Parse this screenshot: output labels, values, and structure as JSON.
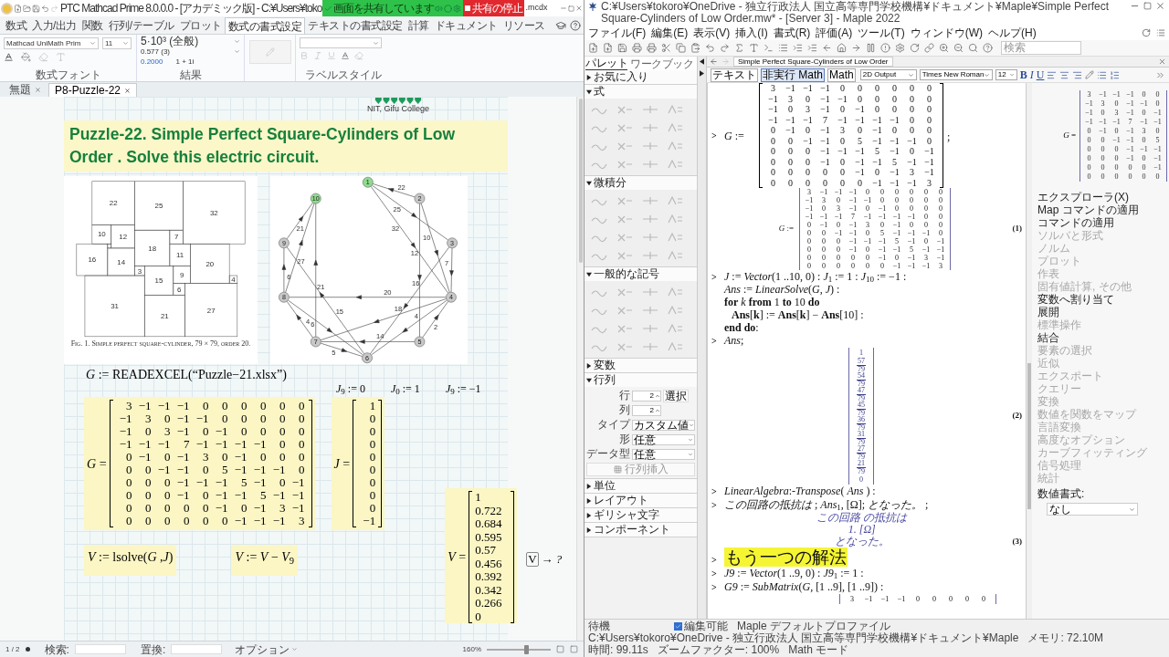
{
  "mathcad": {
    "title": "PTC Mathcad Prime 8.0.0.0 - [アカデミック版] - C:¥Users¥toko",
    "title_end": ".mcdx",
    "share_banner": {
      "text": "画面を共有しています",
      "stop": "共有の停止"
    },
    "ribbon_tabs": [
      {
        "label": "数式",
        "selected": false
      },
      {
        "label": "入力/出力",
        "selected": false
      },
      {
        "label": "関数",
        "selected": false
      },
      {
        "label": "行列/テーブル",
        "selected": false
      },
      {
        "label": "プロット",
        "selected": false
      },
      {
        "label": "数式の書式設定",
        "selected": true
      },
      {
        "label": "テキストの書式設定",
        "selected": false
      },
      {
        "label": "計算",
        "selected": false
      },
      {
        "label": "ドキュメント",
        "selected": false
      },
      {
        "label": "リソース",
        "selected": false
      }
    ],
    "ribbon": {
      "font": "Mathcad UniMath Prim",
      "size": "11",
      "result_format": "5·10³ (全般)",
      "precision": "0.577 (3)",
      "threshold": "0.2000",
      "complex": "1 + 1i",
      "groups": [
        "数式フォント",
        "結果",
        "ラベルスタイル"
      ]
    },
    "doc_tabs": [
      {
        "label": "無題",
        "selected": false
      },
      {
        "label": "P8-Puzzle-22",
        "selected": true
      }
    ],
    "logo": "NIT, Gifu College",
    "heading": "Puzzle-22. Simple Perfect Square-Cylinders of Low Order . Solve this electric circuit.",
    "squares": [
      {
        "label": "22"
      },
      {
        "label": "25"
      },
      {
        "label": "32"
      },
      {
        "label": "10"
      },
      {
        "label": "12"
      },
      {
        "label": "7"
      },
      {
        "label": "18"
      },
      {
        "label": "16"
      },
      {
        "label": "14"
      },
      {
        "label": "11"
      },
      {
        "label": "20"
      },
      {
        "label": "3"
      },
      {
        "label": "15"
      },
      {
        "label": "9"
      },
      {
        "label": "4"
      },
      {
        "label": "6"
      },
      {
        "label": "31"
      },
      {
        "label": "21"
      },
      {
        "label": "27"
      }
    ],
    "caption": "Fig. 1.  Simple perfect square-cylinder, 79 × 79, order 20.",
    "graph": {
      "nodes": [
        {
          "label": "1",
          "color": "#8fdc8f"
        },
        {
          "label": "2",
          "color": "#c8c8c8"
        },
        {
          "label": "3",
          "color": "#c8c8c8"
        },
        {
          "label": "4",
          "color": "#c8c8c8"
        },
        {
          "label": "5",
          "color": "#c8c8c8"
        },
        {
          "label": "6",
          "color": "#c8c8c8"
        },
        {
          "label": "7",
          "color": "#c8c8c8"
        },
        {
          "label": "8",
          "color": "#c8c8c8"
        },
        {
          "label": "9",
          "color": "#c8c8c8"
        },
        {
          "label": "10",
          "color": "#8fdc8f"
        }
      ],
      "edges": [
        {
          "label": "22"
        },
        {
          "label": "25"
        },
        {
          "label": "32"
        },
        {
          "label": "10"
        },
        {
          "label": "12"
        },
        {
          "label": "7"
        },
        {
          "label": "16"
        },
        {
          "label": "20"
        },
        {
          "label": "18"
        },
        {
          "label": "4"
        },
        {
          "label": "2"
        },
        {
          "label": "14"
        },
        {
          "label": "21"
        },
        {
          "label": "21"
        },
        {
          "label": "27"
        },
        {
          "label": "6"
        },
        {
          "label": "15"
        },
        {
          "label": "4"
        },
        {
          "label": "6"
        },
        {
          "label": "5"
        }
      ]
    },
    "readexcel": "*G* := READEXCEL(“Puzzle−21.xlsx”)",
    "j_assign": [
      "*J*$_{9}$ := 0",
      "*J*$_{0}$ := 1",
      "*J*$_{9}$ := −1"
    ],
    "G": {
      "label": "*G* =",
      "rows": [
        [
          "3",
          "−1",
          "−1",
          "−1",
          "0",
          "0",
          "0",
          "0",
          "0",
          "0"
        ],
        [
          "−1",
          "3",
          "0",
          "−1",
          "−1",
          "0",
          "0",
          "0",
          "0",
          "0"
        ],
        [
          "−1",
          "0",
          "3",
          "−1",
          "0",
          "−1",
          "0",
          "0",
          "0",
          "0"
        ],
        [
          "−1",
          "−1",
          "−1",
          "7",
          "−1",
          "−1",
          "−1",
          "−1",
          "0",
          "0"
        ],
        [
          "0",
          "−1",
          "0",
          "−1",
          "3",
          "0",
          "−1",
          "0",
          "0",
          "0"
        ],
        [
          "0",
          "0",
          "−1",
          "−1",
          "0",
          "5",
          "−1",
          "−1",
          "−1",
          "0"
        ],
        [
          "0",
          "0",
          "0",
          "−1",
          "−1",
          "−1",
          "5",
          "−1",
          "0",
          "−1"
        ],
        [
          "0",
          "0",
          "0",
          "−1",
          "0",
          "−1",
          "−1",
          "5",
          "−1",
          "−1"
        ],
        [
          "0",
          "0",
          "0",
          "0",
          "0",
          "−1",
          "0",
          "−1",
          "3",
          "−1"
        ],
        [
          "0",
          "0",
          "0",
          "0",
          "0",
          "0",
          "−1",
          "−1",
          "−1",
          "3"
        ]
      ]
    },
    "J": {
      "label": "*J* =",
      "values": [
        "1",
        "0",
        "0",
        "0",
        "0",
        "0",
        "0",
        "0",
        "0",
        "−1"
      ]
    },
    "lsolve": "*V* := lsolve(*G* ,*J*)",
    "shift": "*V* := *V* − *V*$_{9}$",
    "V": {
      "label": "*V* =",
      "values": [
        "1",
        "0.722",
        "0.684",
        "0.595",
        "0.57",
        "0.456",
        "0.392",
        "0.342",
        "0.266",
        "0"
      ]
    },
    "symbolic": {
      "var": "V",
      "op": "→ ?"
    },
    "status": {
      "page": "1 / 2",
      "search": "検索:",
      "replace": "置換:",
      "options": "オプション",
      "zoom": "160%",
      "zoom_slider": {
        "level": 0.62
      }
    }
  },
  "maple": {
    "title": "C:¥Users¥tokoro¥OneDrive - 独立行政法人 国立高等専門学校機構¥ドキュメント¥Maple¥Simple Perfect Square-Cylinders of Low Order.mw* - [Server 3] - Maple 2022",
    "menu": [
      "ファイル(F)",
      "編集(E)",
      "表示(V)",
      "挿入(I)",
      "書式(R)",
      "評価(A)",
      "ツール(T)",
      "ウィンドウ(W)",
      "ヘルプ(H)"
    ],
    "search_placeholder": "検索",
    "palette_tabs": [
      {
        "label": "パレット",
        "selected": true
      },
      {
        "label": "ワークブック",
        "selected": false
      }
    ],
    "doc_tab": "Simple Perfect Square-Cylinders of Low Order",
    "format_bar": {
      "modes": [
        {
          "label": "テキスト",
          "selected": false
        },
        {
          "label": "非実行 Math",
          "selected": true
        },
        {
          "label": "Math",
          "selected": false
        }
      ],
      "style": "2D Output",
      "font": "Times New Roman",
      "size": "12",
      "text_styles": [
        "B",
        "I",
        "U"
      ]
    },
    "palettes": [
      {
        "label": "お気に入り",
        "expanded": false
      },
      {
        "label": "式",
        "expanded": true,
        "kind": "symbols"
      },
      {
        "label": "微積分",
        "expanded": true,
        "kind": "symbols"
      },
      {
        "label": "一般的な記号",
        "expanded": true,
        "kind": "symbols"
      },
      {
        "label": "変数",
        "expanded": false
      },
      {
        "label": "行列",
        "expanded": true,
        "kind": "matrix",
        "fields": [
          {
            "label": "行",
            "value": "2",
            "kind": "spin"
          },
          {
            "label": "列",
            "value": "2",
            "kind": "spin"
          },
          {
            "label": "タイプ",
            "value": "カスタム値",
            "kind": "select"
          },
          {
            "label": "形",
            "value": "任意",
            "kind": "select"
          },
          {
            "label": "データ型",
            "value": "任意",
            "kind": "select"
          }
        ],
        "select_button": "選択",
        "insert_button": "行列挿入"
      },
      {
        "label": "単位",
        "expanded": false
      },
      {
        "label": "レイアウト",
        "expanded": false
      },
      {
        "label": "ギリシャ文字",
        "expanded": false
      },
      {
        "label": "コンポーネント",
        "expanded": false
      }
    ],
    "worksheet": [
      {
        "kind": "input_matrix",
        "prompt": ">",
        "name": "*G* :=",
        "end": ";",
        "rows": [
          [
            "3",
            "−1",
            "−1",
            "−1",
            "0",
            "0",
            "0",
            "0",
            "0",
            "0"
          ],
          [
            "−1",
            "3",
            "0",
            "−1",
            "−1",
            "0",
            "0",
            "0",
            "0",
            "0"
          ],
          [
            "−1",
            "0",
            "3",
            "−1",
            "0",
            "−1",
            "0",
            "0",
            "0",
            "0"
          ],
          [
            "−1",
            "−1",
            "−1",
            "7",
            "−1",
            "−1",
            "−1",
            "−1",
            "0",
            "0"
          ],
          [
            "0",
            "−1",
            "0",
            "−1",
            "3",
            "0",
            "−1",
            "0",
            "0",
            "0"
          ],
          [
            "0",
            "0",
            "−1",
            "−1",
            "0",
            "5",
            "−1",
            "−1",
            "−1",
            "0"
          ],
          [
            "0",
            "0",
            "0",
            "−1",
            "−1",
            "−1",
            "5",
            "−1",
            "0",
            "−1"
          ],
          [
            "0",
            "0",
            "0",
            "−1",
            "0",
            "−1",
            "−1",
            "5",
            "−1",
            "−1"
          ],
          [
            "0",
            "0",
            "0",
            "0",
            "0",
            "−1",
            "0",
            "−1",
            "3",
            "−1"
          ],
          [
            "0",
            "0",
            "0",
            "0",
            "0",
            "0",
            "−1",
            "−1",
            "−1",
            "3"
          ]
        ]
      },
      {
        "kind": "output_matrix",
        "name": "*G* :=",
        "tag": "(1)",
        "rows": [
          [
            "3",
            "−1",
            "−1",
            "−1",
            "0",
            "0",
            "0",
            "0",
            "0",
            "0"
          ],
          [
            "−1",
            "3",
            "0",
            "−1",
            "−1",
            "0",
            "0",
            "0",
            "0",
            "0"
          ],
          [
            "−1",
            "0",
            "3",
            "−1",
            "0",
            "−1",
            "0",
            "0",
            "0",
            "0"
          ],
          [
            "−1",
            "−1",
            "−1",
            "7",
            "−1",
            "−1",
            "−1",
            "−1",
            "0",
            "0"
          ],
          [
            "0",
            "−1",
            "0",
            "−1",
            "3",
            "0",
            "−1",
            "0",
            "0",
            "0"
          ],
          [
            "0",
            "0",
            "−1",
            "−1",
            "0",
            "5",
            "−1",
            "−1",
            "−1",
            "0"
          ],
          [
            "0",
            "0",
            "0",
            "−1",
            "−1",
            "−1",
            "5",
            "−1",
            "0",
            "−1"
          ],
          [
            "0",
            "0",
            "0",
            "−1",
            "0",
            "−1",
            "−1",
            "5",
            "−1",
            "−1"
          ],
          [
            "0",
            "0",
            "0",
            "0",
            "0",
            "−1",
            "0",
            "−1",
            "3",
            "−1"
          ],
          [
            "0",
            "0",
            "0",
            "0",
            "0",
            "0",
            "−1",
            "−1",
            "−1",
            "3"
          ]
        ]
      },
      {
        "kind": "input",
        "prompt": ">",
        "lines": [
          {
            "text": "*J* := *Vector*(1 ..10, 0) : *J*$_{1}$ := 1 : *J*$_{10}$ := −1 :"
          },
          {
            "text": "*Ans* := *LinearSolve*(*G*, *J*) :"
          },
          {
            "text": "**for** *k* **from** 1 **to** 10 **do**",
            "children": [
              {
                "text": "**Ans**[**k**] := **Ans**[**k**] − **Ans**[10] :"
              }
            ]
          },
          {
            "text": "**end do**:"
          }
        ]
      },
      {
        "kind": "input",
        "prompt": ">",
        "lines": [
          {
            "text": "*Ans*;"
          }
        ]
      },
      {
        "kind": "vector_output",
        "tag": "(2)",
        "entries": [
          {
            "num": "1"
          },
          {
            "num": "57",
            "den": "79"
          },
          {
            "num": "54",
            "den": "79"
          },
          {
            "num": "47",
            "den": "79"
          },
          {
            "num": "45",
            "den": "79"
          },
          {
            "num": "36",
            "den": "79"
          },
          {
            "num": "31",
            "den": "79"
          },
          {
            "num": "27",
            "den": "79"
          },
          {
            "num": "21",
            "den": "79"
          },
          {
            "num": "0"
          }
        ]
      },
      {
        "kind": "input",
        "prompt": ">",
        "lines": [
          {
            "text": "*LinearAlgebra*:-*Transpose*( *Ans* ) :"
          }
        ]
      },
      {
        "kind": "input",
        "prompt": ">",
        "lines": [
          {
            "text": "*この回路の抵抗は* ; *Ans*$_{1}$, [Ω]; *となった。* ;"
          }
        ]
      },
      {
        "kind": "text_output",
        "tag": "(3)",
        "lines": [
          "この回路 の抵抗は",
          "1. [Ω]",
          "となった。"
        ]
      },
      {
        "kind": "heading",
        "prompt": ">",
        "text": "もう一つの解法"
      },
      {
        "kind": "input",
        "prompt": ">",
        "lines": [
          {
            "text": "*J9* := *Vector*(1 ..9, 0) : *J9*$_{1}$ := 1 :"
          }
        ]
      },
      {
        "kind": "input",
        "prompt": ">",
        "lines": [
          {
            "text": "*G9* := *SubMatrix*(*G*, [1 ..9], [1 ..9]) :"
          }
        ]
      },
      {
        "kind": "partial_row",
        "values": [
          "3",
          "−1",
          "−1",
          "−1",
          "0",
          "0",
          "0",
          "0",
          "0"
        ]
      }
    ],
    "side_panel": {
      "name": "*G* =",
      "rows": [
        [
          "3",
          "−1",
          "−1",
          "−1",
          "0",
          "0"
        ],
        [
          "−1",
          "3",
          "0",
          "−1",
          "−1",
          "0"
        ],
        [
          "−1",
          "0",
          "3",
          "−1",
          "0",
          "−1"
        ],
        [
          "−1",
          "−1",
          "−1",
          "7",
          "−1",
          "−1"
        ],
        [
          "0",
          "−1",
          "0",
          "−1",
          "3",
          "0"
        ],
        [
          "0",
          "0",
          "−1",
          "−1",
          "0",
          "5"
        ],
        [
          "0",
          "0",
          "0",
          "−1",
          "−1",
          "−1"
        ],
        [
          "0",
          "0",
          "0",
          "−1",
          "0",
          "−1"
        ],
        [
          "0",
          "0",
          "0",
          "0",
          "0",
          "−1"
        ],
        [
          "0",
          "0",
          "0",
          "0",
          "0",
          "0"
        ]
      ],
      "menu": [
        {
          "label": "エクスプローラ(X)",
          "disabled": false
        },
        {
          "label": "Map コマンドの適用",
          "disabled": false
        },
        {
          "label": "コマンドの適用",
          "disabled": false
        },
        {
          "label": "ソルバと形式",
          "disabled": true
        },
        {
          "label": "ノルム",
          "disabled": true
        },
        {
          "label": "プロット",
          "disabled": true
        },
        {
          "label": "作表",
          "disabled": true
        },
        {
          "label": "固有値計算, その他",
          "disabled": true
        },
        {
          "label": "変数へ割り当て",
          "disabled": false
        },
        {
          "label": "展開",
          "disabled": false
        },
        {
          "label": "標準操作",
          "disabled": true
        },
        {
          "label": "結合",
          "disabled": false
        },
        {
          "label": "要素の選択",
          "disabled": true
        },
        {
          "label": "近似",
          "disabled": true
        },
        {
          "label": "エクスポート",
          "disabled": true
        },
        {
          "label": "クエリー",
          "disabled": true
        },
        {
          "label": "変換",
          "disabled": true
        },
        {
          "label": "数値を関数をマップ",
          "disabled": true
        },
        {
          "label": "言語変換",
          "disabled": true
        },
        {
          "label": "高度なオプション",
          "disabled": true
        },
        {
          "label": "カーブフィッティング",
          "disabled": true
        },
        {
          "label": "信号処理",
          "disabled": true
        },
        {
          "label": "統計",
          "disabled": true
        }
      ],
      "format_label": "数値書式:",
      "format_value": "なし"
    },
    "status": {
      "state": "待機",
      "editable": {
        "label": "編集可能",
        "checked": true
      },
      "items": [
        "Maple デフォルトプロファイル",
        "C:¥Users¥tokoro¥OneDrive - 独立行政法人 国立高等専門学校機構¥ドキュメント¥Maple",
        "メモリ: 72.10M",
        "時間: 99.11s",
        "ズームファクター: 100%",
        "Math モード"
      ]
    }
  }
}
